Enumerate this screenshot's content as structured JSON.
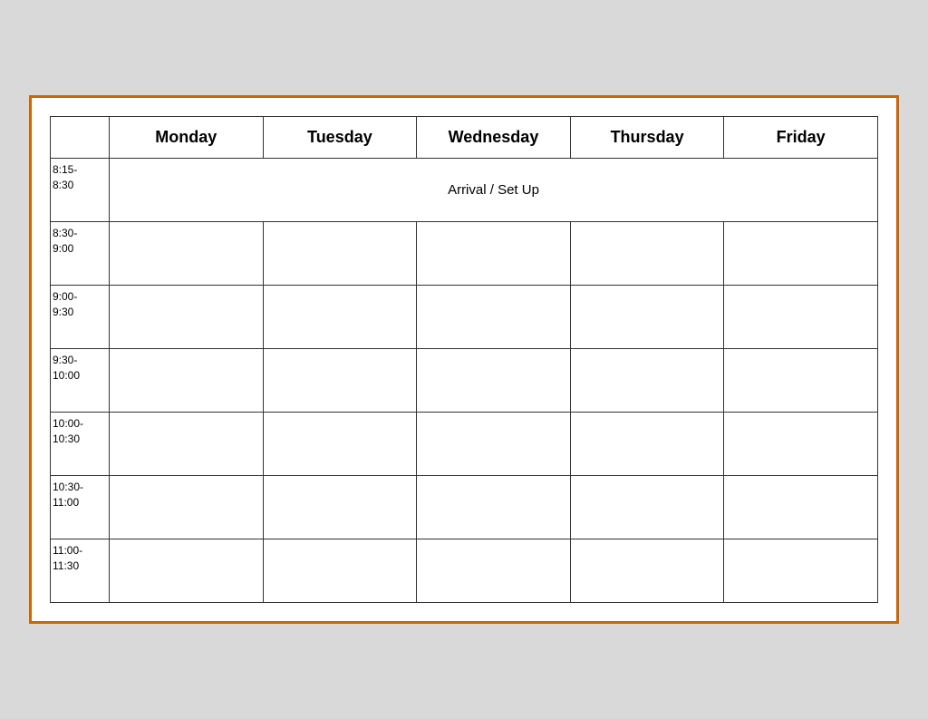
{
  "table": {
    "headers": {
      "empty": "",
      "monday": "Monday",
      "tuesday": "Tuesday",
      "wednesday": "Wednesday",
      "thursday": "Thursday",
      "friday": "Friday"
    },
    "arrival_row": {
      "time": "8:15-\n8:30",
      "label": "Arrival / Set Up"
    },
    "rows": [
      {
        "time": "8:30-\n9:00"
      },
      {
        "time": "9:00-\n9:30"
      },
      {
        "time": "9:30-\n10:00"
      },
      {
        "time": "10:00-\n10:30"
      },
      {
        "time": "10:30-\n11:00"
      },
      {
        "time": "11:00-\n11:30"
      }
    ]
  }
}
